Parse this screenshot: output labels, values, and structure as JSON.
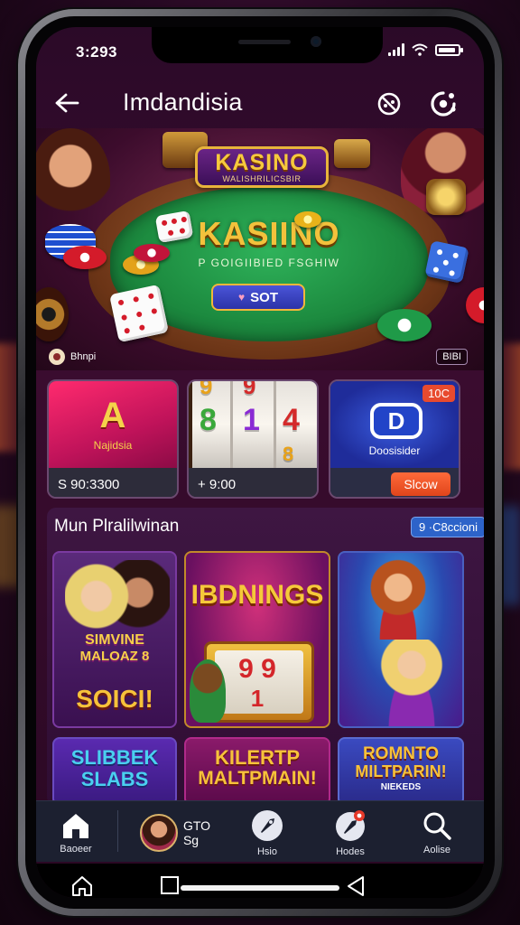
{
  "status": {
    "time": "3:293"
  },
  "header": {
    "title": "Imdandisia",
    "back_icon": "back-arrow-icon",
    "icons": [
      "game-controller-icon",
      "settings-dots-icon"
    ]
  },
  "banner": {
    "plaque_title": "KASINO",
    "plaque_subtitle": "WALISHRILICSBIR",
    "felt_title": "KASIINO",
    "felt_subtitle": "P GOIGIIBIED FSGHIW",
    "button_label": "SOT",
    "left_label": "Bhnpi",
    "right_tag": "BIBI"
  },
  "cards": [
    {
      "big": "A",
      "label": "Najidsia",
      "footer": "S 90:3300"
    },
    {
      "reels": [
        "8",
        "1",
        "4"
      ],
      "footer": "+ 9:00"
    },
    {
      "logo": "D",
      "label": "Doosisider",
      "badge": "10C",
      "button": "Slcow"
    }
  ],
  "section": {
    "title": "Mun Plralilwinan",
    "button": "9 ·C8ccioni",
    "tiles": [
      {
        "text1": "SIMVINE",
        "text2": "MALOAZ 8",
        "text3": "SOICI!"
      },
      {
        "text1": "IBDNINGS",
        "text2": "9 9",
        "text3": "1"
      },
      {
        "text1": ""
      },
      {
        "text1": "SLIBBEK",
        "text2": "SLABS"
      },
      {
        "text1": "KILERTP",
        "text2": "MALTPMAIN!"
      },
      {
        "text1": "ROMNTO",
        "text2": "MILTPARIN!",
        "text3": "NIEKEDS"
      }
    ]
  },
  "navbar": {
    "items": [
      {
        "label": "Baoeer",
        "icon": "home-icon"
      },
      {
        "label": "GTO",
        "sub": "Sg",
        "icon": "avatar"
      },
      {
        "label": "Hsio",
        "icon": "rocket-icon"
      },
      {
        "label": "Hodes",
        "icon": "rocket-badge-icon"
      },
      {
        "label": "Aolise",
        "icon": "search-icon"
      }
    ]
  },
  "colors": {
    "accent_gold": "#f3c23c",
    "felt_green": "#1d8c40",
    "nav_bg": "#1c2030",
    "brand_purple": "#3a0c2f"
  }
}
